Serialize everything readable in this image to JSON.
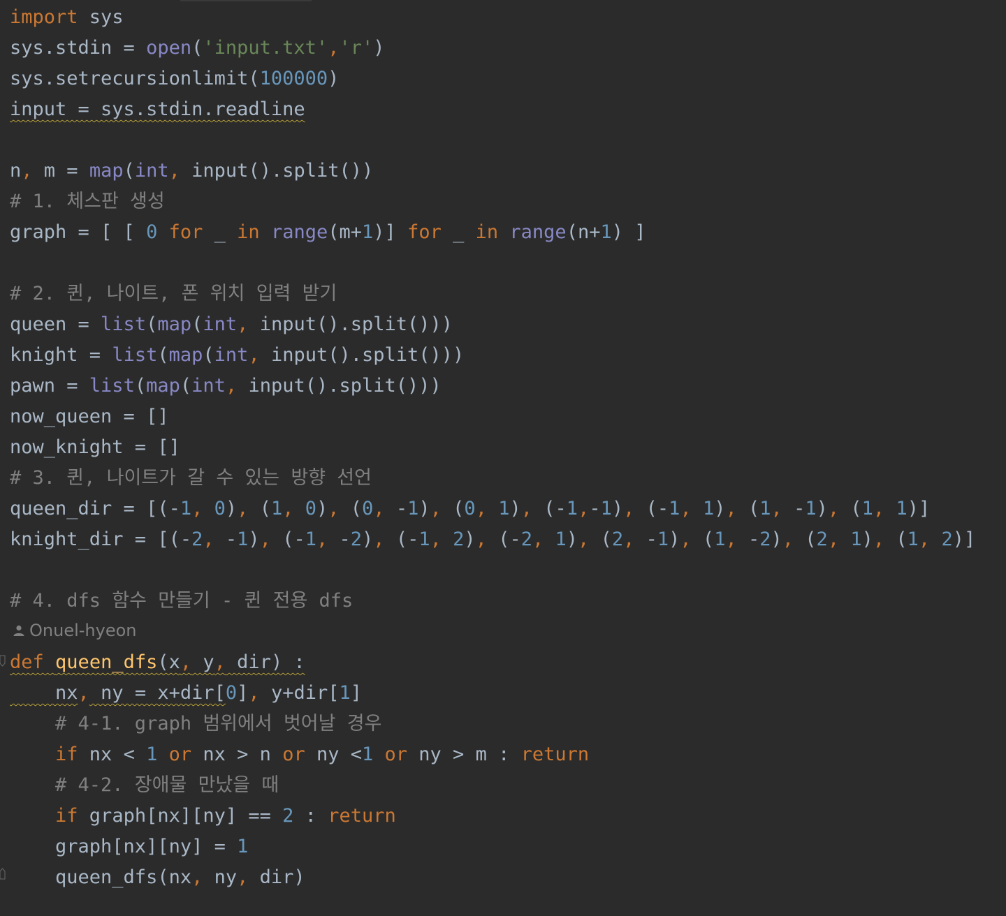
{
  "editor": {
    "theme": "darcula",
    "colors": {
      "background": "#2b2b2b",
      "keyword": "#cc7832",
      "builtin": "#8888c6",
      "string": "#6a8759",
      "number": "#6897bb",
      "function": "#ffc66d",
      "comment": "#808080",
      "plain": "#a9b7c6"
    },
    "author_hint": {
      "icon": "person-icon",
      "name": "Onuel-hyeon"
    },
    "lines": [
      [
        [
          "kw",
          "import"
        ],
        [
          "p",
          " sys"
        ]
      ],
      [
        [
          "p",
          "sys.stdin = "
        ],
        [
          "bi",
          "open"
        ],
        [
          "p",
          "("
        ],
        [
          "str",
          "'input.txt'"
        ],
        [
          "kw",
          ","
        ],
        [
          "str",
          "'r'"
        ],
        [
          "p",
          ")"
        ]
      ],
      [
        [
          "p",
          "sys.setrecursionlimit("
        ],
        [
          "num",
          "100000"
        ],
        [
          "p",
          ")"
        ]
      ],
      [
        [
          "p",
          "input = sys.stdin.readline"
        ]
      ],
      [],
      [
        [
          "p",
          "n"
        ],
        [
          "kw",
          ","
        ],
        [
          "p",
          " m = "
        ],
        [
          "bi",
          "map"
        ],
        [
          "p",
          "("
        ],
        [
          "bi",
          "int"
        ],
        [
          "kw",
          ","
        ],
        [
          "p",
          " input().split())"
        ]
      ],
      [
        [
          "cmt",
          "# 1. 체스판 생성"
        ]
      ],
      [
        [
          "p",
          "graph = [ [ "
        ],
        [
          "num",
          "0"
        ],
        [
          "p",
          " "
        ],
        [
          "kw",
          "for"
        ],
        [
          "p",
          " _ "
        ],
        [
          "kw",
          "in"
        ],
        [
          "p",
          " "
        ],
        [
          "bi",
          "range"
        ],
        [
          "p",
          "(m+"
        ],
        [
          "num",
          "1"
        ],
        [
          "p",
          ")] "
        ],
        [
          "kw",
          "for"
        ],
        [
          "p",
          " _ "
        ],
        [
          "kw",
          "in"
        ],
        [
          "p",
          " "
        ],
        [
          "bi",
          "range"
        ],
        [
          "p",
          "(n+"
        ],
        [
          "num",
          "1"
        ],
        [
          "p",
          ") ]"
        ]
      ],
      [],
      [
        [
          "cmt",
          "# 2. 퀸, 나이트, 폰 위치 입력 받기"
        ]
      ],
      [
        [
          "p",
          "queen = "
        ],
        [
          "bi",
          "list"
        ],
        [
          "p",
          "("
        ],
        [
          "bi",
          "map"
        ],
        [
          "p",
          "("
        ],
        [
          "bi",
          "int"
        ],
        [
          "kw",
          ","
        ],
        [
          "p",
          " input().split()))"
        ]
      ],
      [
        [
          "p",
          "knight = "
        ],
        [
          "bi",
          "list"
        ],
        [
          "p",
          "("
        ],
        [
          "bi",
          "map"
        ],
        [
          "p",
          "("
        ],
        [
          "bi",
          "int"
        ],
        [
          "kw",
          ","
        ],
        [
          "p",
          " input().split()))"
        ]
      ],
      [
        [
          "p",
          "pawn = "
        ],
        [
          "bi",
          "list"
        ],
        [
          "p",
          "("
        ],
        [
          "bi",
          "map"
        ],
        [
          "p",
          "("
        ],
        [
          "bi",
          "int"
        ],
        [
          "kw",
          ","
        ],
        [
          "p",
          " input().split()))"
        ]
      ],
      [
        [
          "p",
          "now_queen = []"
        ]
      ],
      [
        [
          "p",
          "now_knight = []"
        ]
      ],
      [
        [
          "cmt",
          "# 3. 퀸, 나이트가 갈 수 있는 방향 선언"
        ]
      ],
      [
        [
          "p",
          "queen_dir = [(-"
        ],
        [
          "num",
          "1"
        ],
        [
          "kw",
          ","
        ],
        [
          "p",
          " "
        ],
        [
          "num",
          "0"
        ],
        [
          "p",
          ")"
        ],
        [
          "kw",
          ","
        ],
        [
          "p",
          " ("
        ],
        [
          "num",
          "1"
        ],
        [
          "kw",
          ","
        ],
        [
          "p",
          " "
        ],
        [
          "num",
          "0"
        ],
        [
          "p",
          ")"
        ],
        [
          "kw",
          ","
        ],
        [
          "p",
          " ("
        ],
        [
          "num",
          "0"
        ],
        [
          "kw",
          ","
        ],
        [
          "p",
          " -"
        ],
        [
          "num",
          "1"
        ],
        [
          "p",
          ")"
        ],
        [
          "kw",
          ","
        ],
        [
          "p",
          " ("
        ],
        [
          "num",
          "0"
        ],
        [
          "kw",
          ","
        ],
        [
          "p",
          " "
        ],
        [
          "num",
          "1"
        ],
        [
          "p",
          ")"
        ],
        [
          "kw",
          ","
        ],
        [
          "p",
          " (-"
        ],
        [
          "num",
          "1"
        ],
        [
          "kw",
          ","
        ],
        [
          "p",
          "-"
        ],
        [
          "num",
          "1"
        ],
        [
          "p",
          ")"
        ],
        [
          "kw",
          ","
        ],
        [
          "p",
          " (-"
        ],
        [
          "num",
          "1"
        ],
        [
          "kw",
          ","
        ],
        [
          "p",
          " "
        ],
        [
          "num",
          "1"
        ],
        [
          "p",
          ")"
        ],
        [
          "kw",
          ","
        ],
        [
          "p",
          " ("
        ],
        [
          "num",
          "1"
        ],
        [
          "kw",
          ","
        ],
        [
          "p",
          " -"
        ],
        [
          "num",
          "1"
        ],
        [
          "p",
          ")"
        ],
        [
          "kw",
          ","
        ],
        [
          "p",
          " ("
        ],
        [
          "num",
          "1"
        ],
        [
          "kw",
          ","
        ],
        [
          "p",
          " "
        ],
        [
          "num",
          "1"
        ],
        [
          "p",
          ")]"
        ]
      ],
      [
        [
          "p",
          "knight_dir = [(-"
        ],
        [
          "num",
          "2"
        ],
        [
          "kw",
          ","
        ],
        [
          "p",
          " -"
        ],
        [
          "num",
          "1"
        ],
        [
          "p",
          ")"
        ],
        [
          "kw",
          ","
        ],
        [
          "p",
          " (-"
        ],
        [
          "num",
          "1"
        ],
        [
          "kw",
          ","
        ],
        [
          "p",
          " -"
        ],
        [
          "num",
          "2"
        ],
        [
          "p",
          ")"
        ],
        [
          "kw",
          ","
        ],
        [
          "p",
          " (-"
        ],
        [
          "num",
          "1"
        ],
        [
          "kw",
          ","
        ],
        [
          "p",
          " "
        ],
        [
          "num",
          "2"
        ],
        [
          "p",
          ")"
        ],
        [
          "kw",
          ","
        ],
        [
          "p",
          " (-"
        ],
        [
          "num",
          "2"
        ],
        [
          "kw",
          ","
        ],
        [
          "p",
          " "
        ],
        [
          "num",
          "1"
        ],
        [
          "p",
          ")"
        ],
        [
          "kw",
          ","
        ],
        [
          "p",
          " ("
        ],
        [
          "num",
          "2"
        ],
        [
          "kw",
          ","
        ],
        [
          "p",
          " -"
        ],
        [
          "num",
          "1"
        ],
        [
          "p",
          ")"
        ],
        [
          "kw",
          ","
        ],
        [
          "p",
          " ("
        ],
        [
          "num",
          "1"
        ],
        [
          "kw",
          ","
        ],
        [
          "p",
          " -"
        ],
        [
          "num",
          "2"
        ],
        [
          "p",
          ")"
        ],
        [
          "kw",
          ","
        ],
        [
          "p",
          " ("
        ],
        [
          "num",
          "2"
        ],
        [
          "kw",
          ","
        ],
        [
          "p",
          " "
        ],
        [
          "num",
          "1"
        ],
        [
          "p",
          ")"
        ],
        [
          "kw",
          ","
        ],
        [
          "p",
          " ("
        ],
        [
          "num",
          "1"
        ],
        [
          "kw",
          ","
        ],
        [
          "p",
          " "
        ],
        [
          "num",
          "2"
        ],
        [
          "p",
          ")]"
        ]
      ],
      [],
      [
        [
          "cmt",
          "# 4. dfs 함수 만들기 - 퀸 전용 dfs"
        ]
      ],
      [
        [
          "kw",
          "def"
        ],
        [
          "p",
          " "
        ],
        [
          "fn",
          "queen_dfs"
        ],
        [
          "p",
          "(x"
        ],
        [
          "kw",
          ","
        ],
        [
          "p",
          " y"
        ],
        [
          "kw",
          ","
        ],
        [
          "p",
          " dir) :"
        ]
      ],
      [
        [
          "p",
          "    nx"
        ],
        [
          "kw",
          ","
        ],
        [
          "p",
          " ny = x+dir["
        ],
        [
          "num",
          "0"
        ],
        [
          "p",
          "]"
        ],
        [
          "kw",
          ","
        ],
        [
          "p",
          " y+dir["
        ],
        [
          "num",
          "1"
        ],
        [
          "p",
          "]"
        ]
      ],
      [
        [
          "cmt",
          "    # 4-1. graph 범위에서 벗어날 경우"
        ]
      ],
      [
        [
          "p",
          "    "
        ],
        [
          "kw",
          "if"
        ],
        [
          "p",
          " nx < "
        ],
        [
          "num",
          "1"
        ],
        [
          "p",
          " "
        ],
        [
          "kw",
          "or"
        ],
        [
          "p",
          " nx > n "
        ],
        [
          "kw",
          "or"
        ],
        [
          "p",
          " ny <"
        ],
        [
          "num",
          "1"
        ],
        [
          "p",
          " "
        ],
        [
          "kw",
          "or"
        ],
        [
          "p",
          " ny > m : "
        ],
        [
          "kw",
          "return"
        ]
      ],
      [
        [
          "cmt",
          "    # 4-2. 장애물 만났을 때"
        ]
      ],
      [
        [
          "p",
          "    "
        ],
        [
          "kw",
          "if"
        ],
        [
          "p",
          " graph[nx][ny] == "
        ],
        [
          "num",
          "2"
        ],
        [
          "p",
          " : "
        ],
        [
          "kw",
          "return"
        ]
      ],
      [
        [
          "p",
          "    graph[nx][ny] = "
        ],
        [
          "num",
          "1"
        ]
      ],
      [
        [
          "p",
          "    queen_dfs(nx"
        ],
        [
          "kw",
          ","
        ],
        [
          "p",
          " ny"
        ],
        [
          "kw",
          ","
        ],
        [
          "p",
          " dir)"
        ]
      ]
    ]
  }
}
